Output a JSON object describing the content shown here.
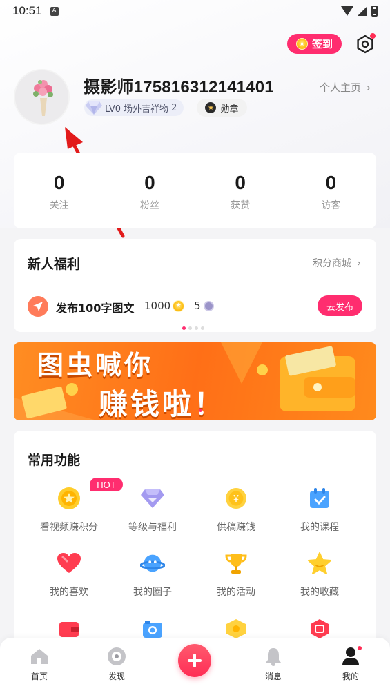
{
  "status_bar": {
    "time": "10:51",
    "sim_label": "A"
  },
  "header": {
    "checkin_label": "签到"
  },
  "profile": {
    "username": "摄影师175816312141401",
    "homepage_label": "个人主页",
    "level_label": "LV0 场外吉祥物",
    "level_value": "2",
    "medal_label": "勋章"
  },
  "stats": [
    {
      "value": "0",
      "label": "关注"
    },
    {
      "value": "0",
      "label": "粉丝"
    },
    {
      "value": "0",
      "label": "获赞"
    },
    {
      "value": "0",
      "label": "访客"
    }
  ],
  "welfare": {
    "title": "新人福利",
    "mall_label": "积分商城",
    "task_label": "发布100字图文",
    "coins": "1000",
    "gems": "5",
    "publish_label": "去发布"
  },
  "banner": {
    "line1": "图虫喊你",
    "line2": "赚钱啦！"
  },
  "features": {
    "title": "常用功能",
    "hot_label": "HOT",
    "items": [
      {
        "label": "看视频赚积分",
        "icon": "coin-icon"
      },
      {
        "label": "等级与福利",
        "icon": "diamond-icon"
      },
      {
        "label": "供稿赚钱",
        "icon": "yen-coin-icon"
      },
      {
        "label": "我的课程",
        "icon": "calendar-icon"
      },
      {
        "label": "我的喜欢",
        "icon": "heart-icon"
      },
      {
        "label": "我的圈子",
        "icon": "planet-icon"
      },
      {
        "label": "我的活动",
        "icon": "trophy-icon"
      },
      {
        "label": "我的收藏",
        "icon": "star-icon"
      }
    ]
  },
  "bottom_nav": [
    {
      "label": "首页",
      "icon": "home-icon"
    },
    {
      "label": "发现",
      "icon": "discover-icon"
    },
    {
      "label": "消息",
      "icon": "bell-icon"
    },
    {
      "label": "我的",
      "icon": "user-icon"
    }
  ],
  "colors": {
    "accent": "#ff2d6f",
    "banner": "#ff7a1a"
  }
}
